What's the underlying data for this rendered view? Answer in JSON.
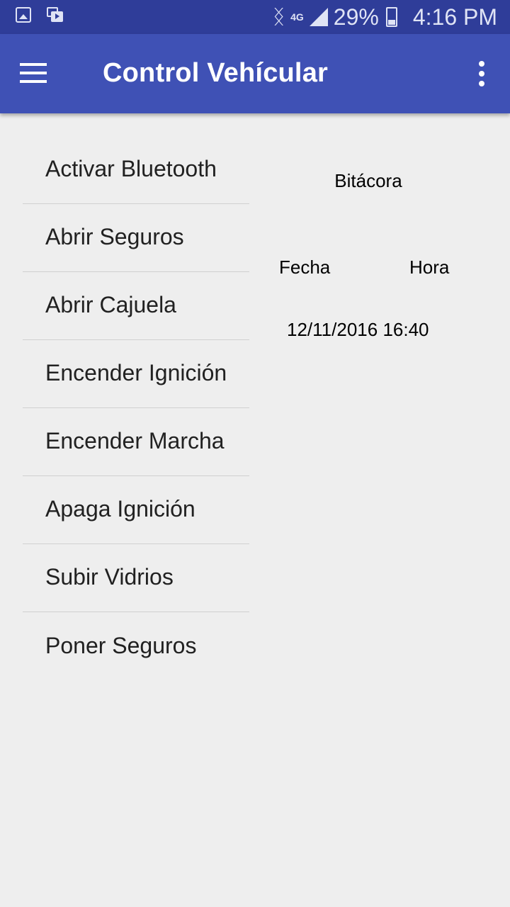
{
  "status_bar": {
    "network": "4G",
    "battery": "29%",
    "time": "4:16 PM",
    "icons": [
      "gallery-icon",
      "media-icon",
      "bluetooth-icon",
      "signal-icon",
      "battery-icon"
    ]
  },
  "app_bar": {
    "title": "Control Vehícular",
    "background": "#3f51b5",
    "icons": [
      "menu-icon",
      "overflow-icon"
    ]
  },
  "commands": [
    {
      "label": "Activar Bluetooth"
    },
    {
      "label": "Abrir Seguros"
    },
    {
      "label": "Abrir Cajuela"
    },
    {
      "label": "Encender Ignición"
    },
    {
      "label": "Encender Marcha"
    },
    {
      "label": "Apaga Ignición"
    },
    {
      "label": "Subir Vidrios"
    },
    {
      "label": "Poner Seguros"
    }
  ],
  "log": {
    "title": "Bitácora",
    "columns": [
      "Fecha",
      "Hora"
    ],
    "rows": [
      {
        "fecha": "12/11/2016",
        "hora": "16:40"
      }
    ]
  }
}
